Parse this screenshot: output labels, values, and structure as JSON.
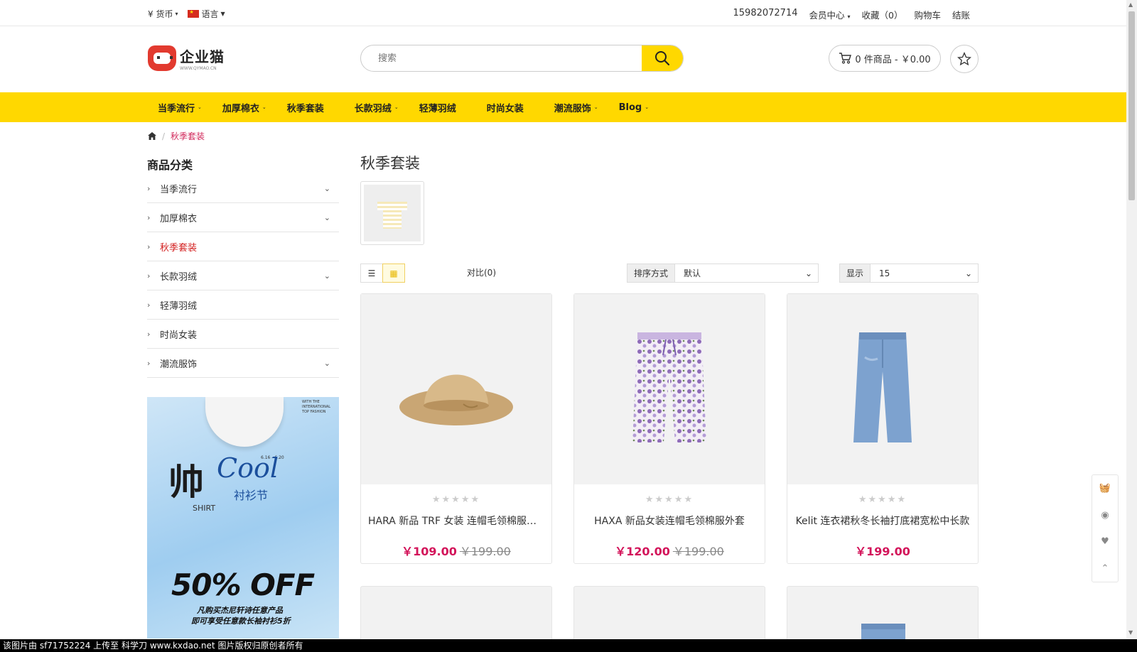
{
  "topbar": {
    "currency": "¥ 货币",
    "language": "语言",
    "phone": "15982072714",
    "member": "会员中心",
    "favorites": "收藏（0）",
    "cart": "购物车",
    "checkout": "结账"
  },
  "header": {
    "logo_cn": "企业猫",
    "logo_en": "WWW.QYMAO.CN",
    "search_placeholder": "搜索",
    "cart_summary": "0 件商品 - ￥0.00"
  },
  "nav": [
    {
      "label": "当季流行",
      "dropdown": true
    },
    {
      "label": "加厚棉衣",
      "dropdown": true
    },
    {
      "label": "秋季套装",
      "dropdown": false
    },
    {
      "label": "长款羽绒",
      "dropdown": true
    },
    {
      "label": "轻薄羽绒",
      "dropdown": false
    },
    {
      "label": "时尚女装",
      "dropdown": false
    },
    {
      "label": "潮流服饰",
      "dropdown": true
    },
    {
      "label": "Blog",
      "dropdown": true
    }
  ],
  "breadcrumb": {
    "current": "秋季套装"
  },
  "sidebar": {
    "title": "商品分类",
    "items": [
      {
        "label": "当季流行",
        "expandable": true,
        "active": false
      },
      {
        "label": "加厚棉衣",
        "expandable": true,
        "active": false
      },
      {
        "label": "秋季套装",
        "expandable": false,
        "active": true
      },
      {
        "label": "长款羽绒",
        "expandable": true,
        "active": false
      },
      {
        "label": "轻薄羽绒",
        "expandable": false,
        "active": false
      },
      {
        "label": "时尚女装",
        "expandable": false,
        "active": false
      },
      {
        "label": "潮流服饰",
        "expandable": true,
        "active": false
      }
    ],
    "banner": {
      "char": "帅",
      "cool": "Cool",
      "festival": "衬衫节",
      "shirt": "SHIRT",
      "date": "6.16 - 6.20",
      "tagline": "WITH THE INTERNATIONAL TOP FASHION",
      "offer": "50% OFF",
      "line1": "凡购买杰尼轩诗任意产品",
      "line2": "即可享受任意款长袖衬衫5折"
    }
  },
  "main": {
    "title": "秋季套装",
    "compare": "对比(0)",
    "sort_label": "排序方式",
    "sort_value": "默认",
    "show_label": "显示",
    "show_value": "15"
  },
  "products": [
    {
      "name": "HARA 新品 TRF 女装 连帽毛领棉服外套",
      "price": "￥109.00",
      "old_price": "￥199.00",
      "rating": 0,
      "image": "hat"
    },
    {
      "name": "HAXA 新品女装连帽毛领棉服外套",
      "price": "￥120.00",
      "old_price": "￥199.00",
      "rating": 0,
      "image": "floral-pants"
    },
    {
      "name": "Kelit 连衣裙秋冬长袖打底裙宽松中长款",
      "price": "￥199.00",
      "old_price": "",
      "rating": 0,
      "image": "jeans"
    }
  ],
  "watermark": "该图片由 sf71752224 上传至 科学刀 www.kxdao.net 图片版权归原创者所有",
  "colors": {
    "accent": "#ffd800",
    "price": "#d3145a",
    "active": "#d31f1f"
  }
}
